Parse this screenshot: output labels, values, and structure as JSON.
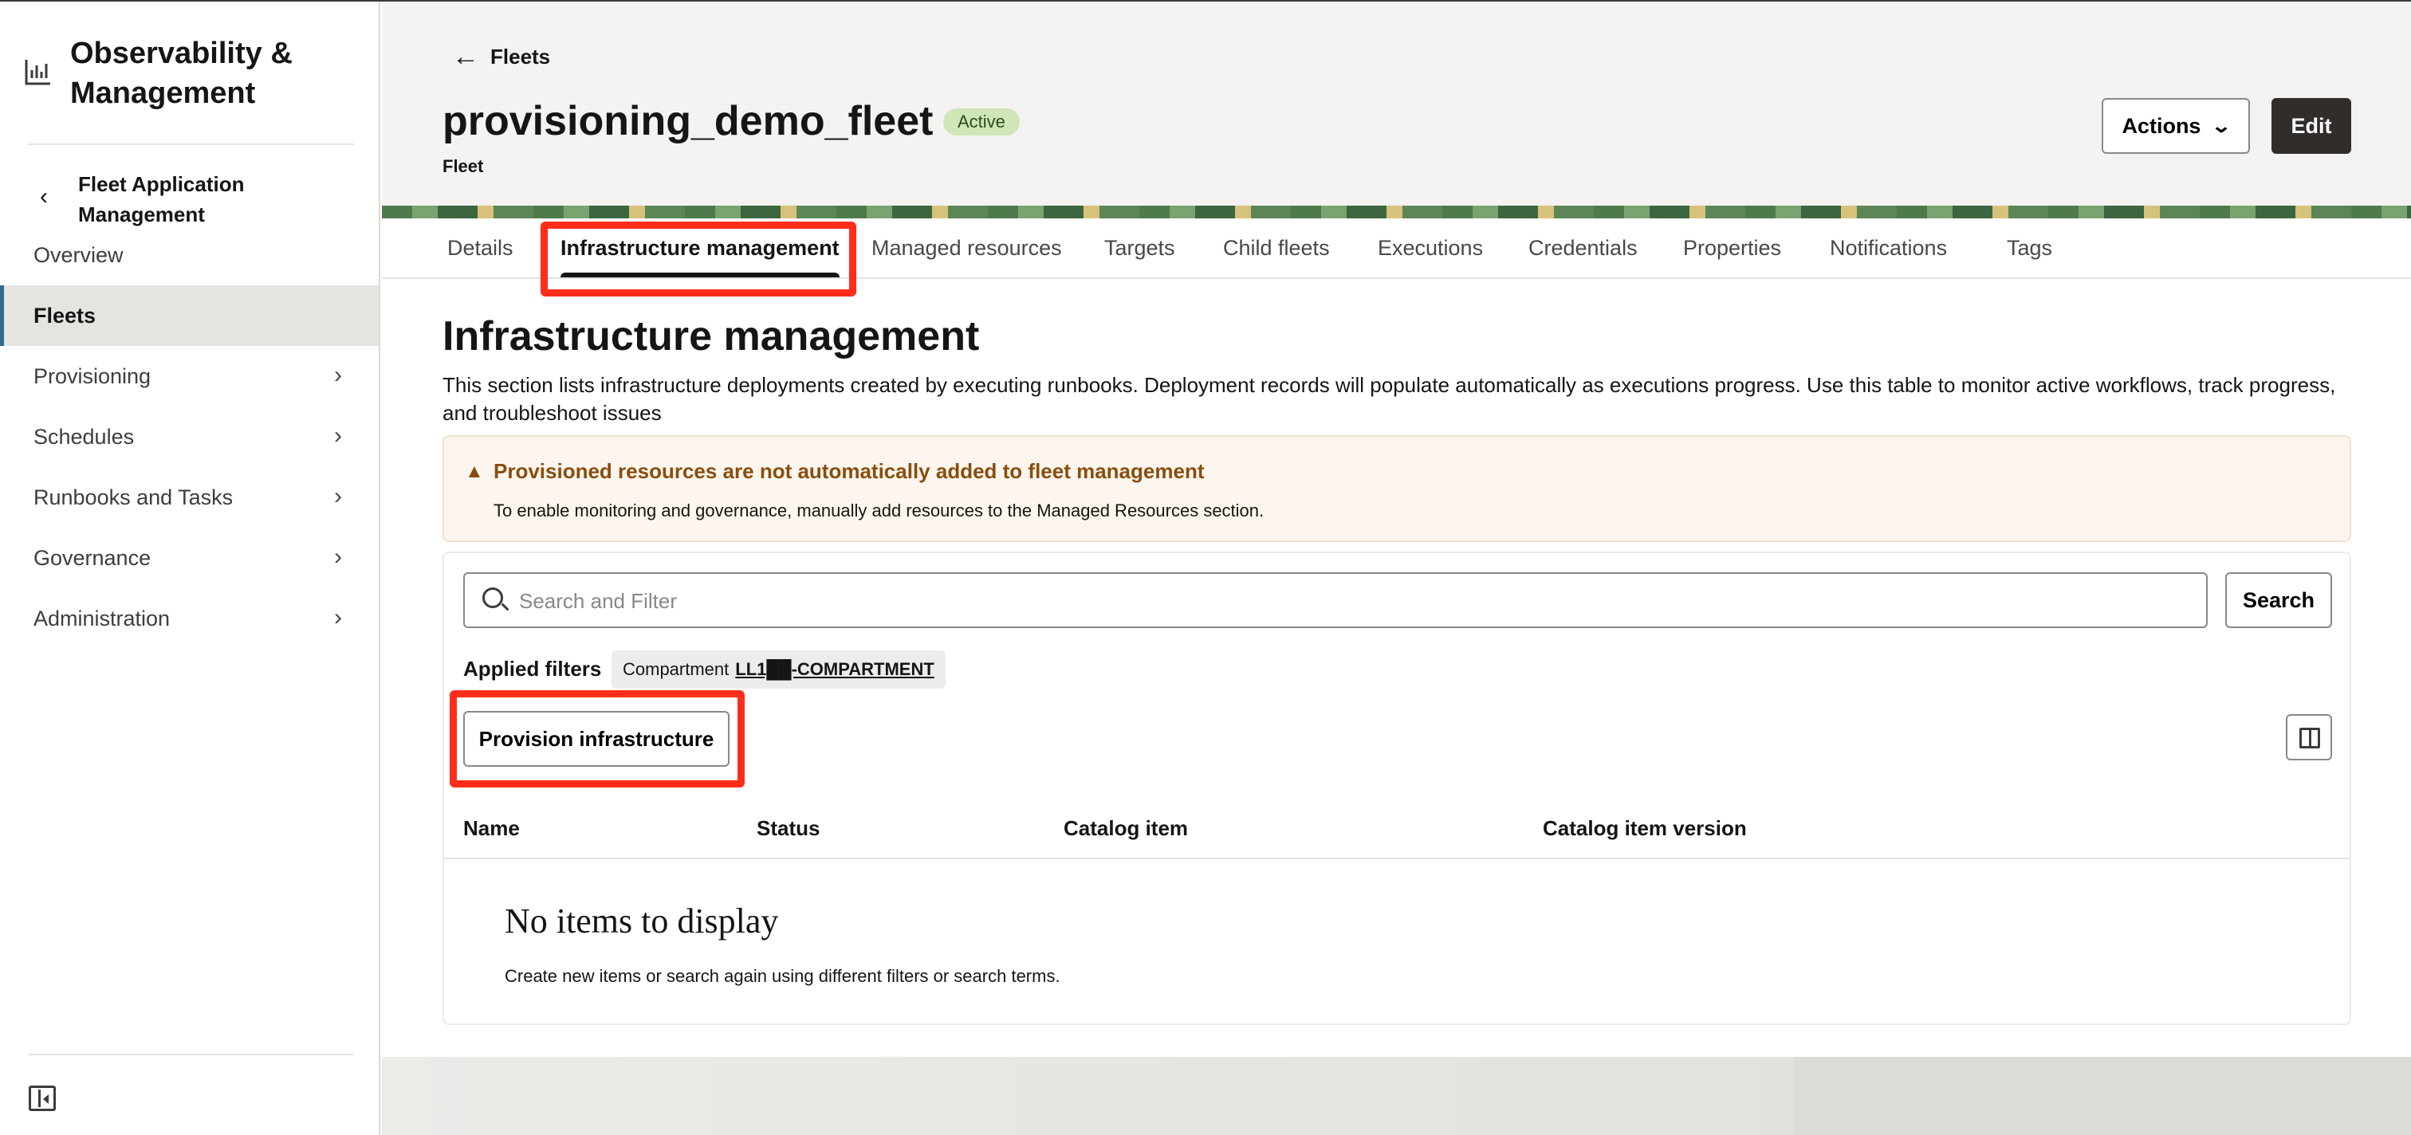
{
  "sidebar": {
    "app_title": "Observability & Management",
    "back_label": "Fleet Application Management",
    "items": [
      {
        "label": "Overview",
        "has_submenu": false,
        "active": false
      },
      {
        "label": "Fleets",
        "has_submenu": false,
        "active": true
      },
      {
        "label": "Provisioning",
        "has_submenu": true,
        "active": false
      },
      {
        "label": "Schedules",
        "has_submenu": true,
        "active": false
      },
      {
        "label": "Runbooks and Tasks",
        "has_submenu": true,
        "active": false
      },
      {
        "label": "Governance",
        "has_submenu": true,
        "active": false
      },
      {
        "label": "Administration",
        "has_submenu": true,
        "active": false
      }
    ]
  },
  "header": {
    "back_link": "Fleets",
    "title": "provisioning_demo_fleet",
    "status": "Active",
    "subtitle": "Fleet",
    "actions_label": "Actions",
    "edit_label": "Edit"
  },
  "tabs": [
    {
      "label": "Details",
      "active": false
    },
    {
      "label": "Infrastructure management",
      "active": true
    },
    {
      "label": "Managed resources",
      "active": false
    },
    {
      "label": "Targets",
      "active": false
    },
    {
      "label": "Child fleets",
      "active": false
    },
    {
      "label": "Executions",
      "active": false
    },
    {
      "label": "Credentials",
      "active": false
    },
    {
      "label": "Properties",
      "active": false
    },
    {
      "label": "Notifications",
      "active": false
    },
    {
      "label": "Tags",
      "active": false
    }
  ],
  "section": {
    "title": "Infrastructure management",
    "description": "This section lists infrastructure deployments created by executing runbooks. Deployment records will populate automatically as executions progress. Use this table to monitor active workflows, track progress, and troubleshoot issues"
  },
  "warning": {
    "title": "Provisioned resources are not automatically added to fleet management",
    "message": "To enable monitoring and governance, manually add resources to the Managed Resources section."
  },
  "search": {
    "placeholder": "Search and Filter",
    "button_label": "Search"
  },
  "filters": {
    "label": "Applied filters",
    "chip_key": "Compartment",
    "chip_value": "LL1██-COMPARTMENT"
  },
  "provision_button": "Provision infrastructure",
  "table": {
    "columns": [
      "Name",
      "Status",
      "Catalog item",
      "Catalog item version"
    ],
    "empty_title": "No items to display",
    "empty_message": "Create new items or search again using different filters or search terms."
  },
  "colors": {
    "accent": "#2f6b8e",
    "highlight": "#ff2d1a",
    "warning_text": "#8a4d0d",
    "badge_bg": "#cfe6b8"
  }
}
